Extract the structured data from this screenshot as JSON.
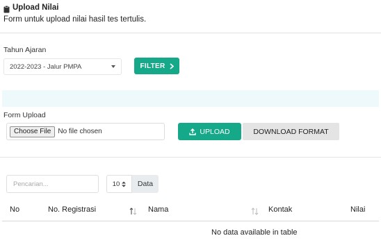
{
  "header": {
    "title": "Upload Nilai",
    "subtitle": "Form untuk upload nilai hasil tes tertulis."
  },
  "filter": {
    "label": "Tahun Ajaran",
    "selected": "2022-2023 - Jalur PMPA",
    "button_label": "FILTER"
  },
  "upload": {
    "label": "Form Upload",
    "choose_file_label": "Choose File",
    "no_file_text": "No file chosen",
    "upload_button": "UPLOAD",
    "download_button": "DOWNLOAD FORMAT"
  },
  "table_controls": {
    "search_placeholder": "Pencarian...",
    "page_size": "10",
    "page_size_addon": "Data"
  },
  "table": {
    "columns": [
      "No",
      "No. Registrasi",
      "Nama",
      "Kontak",
      "Nilai"
    ],
    "empty_message": "No data available in table"
  },
  "colors": {
    "accent": "#16a989",
    "info_bar": "#eef9fb",
    "secondary_button": "#e4e4e4"
  }
}
